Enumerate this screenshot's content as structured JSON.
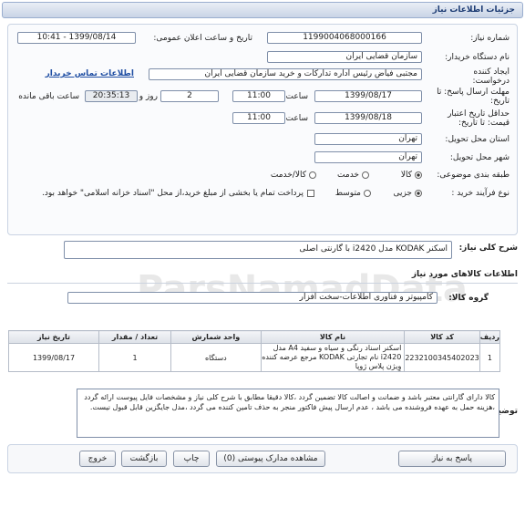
{
  "header": {
    "title": "جزئیات اطلاعات نیاز"
  },
  "form": {
    "need_number_label": "شماره نیاز:",
    "need_number": "1199004068000166",
    "announce_label": "تاریخ و ساعت اعلان عمومی:",
    "announce_value": "1399/08/14 - 10:41",
    "buyer_org_label": "نام دستگاه خریدار:",
    "buyer_org": "سازمان قضایی ایران",
    "creator_label": "ایجاد کننده درخواست:",
    "creator": "مجتبی  فیاض رئیس اداره تدارکات و خرید سازمان قضایی ایران",
    "contact_link": "اطلاعات تماس خریدار",
    "reply_deadline_label": "مهلت ارسال پاسخ: تا تاریخ:",
    "reply_date": "1399/08/17",
    "time_label": "ساعت",
    "reply_time": "11:00",
    "days_value": "2",
    "days_label": "روز و",
    "remaining_time": "20:35:13",
    "remaining_label": "ساعت باقی مانده",
    "validity_label": "حداقل تاریخ اعتبار قیمت: تا تاریخ:",
    "validity_date": "1399/08/18",
    "validity_time": "11:00",
    "province_label": "استان محل تحویل:",
    "province": "تهران",
    "city_label": "شهر محل تحویل:",
    "city": "تهران",
    "category_label": "طبقه بندی موضوعی:",
    "category_options": [
      "کالا",
      "خدمت",
      "کالا/خدمت"
    ],
    "process_label": "نوع فرآیند خرید :",
    "process_options": [
      "جزیی",
      "متوسط"
    ],
    "payment_note": "پرداخت تمام یا بخشی از مبلغ خرید،از محل \"اسناد خزانه اسلامی\" خواهد بود."
  },
  "summary": {
    "label": "شرح کلی نیاز:",
    "text": "اسکنر KODAK مدل  i2420 با گارنتی اصلی"
  },
  "goods_info": {
    "title": "اطلاعات کالاهای مورد نیاز",
    "group_label": "گروه کالا:",
    "group_value": "کامپیوتر و فناوری اطلاعات-سخت افزار"
  },
  "table": {
    "headers": [
      "ردیف",
      "کد کالا",
      "نام کالا",
      "واحد شمارش",
      "تعداد / مقدار",
      "تاریخ نیاز"
    ],
    "rows": [
      {
        "row": "1",
        "code": "2232100345402023",
        "name": "اسکنر اسناد رنگی و سیاه و سفید A4 مدل i2420 نام تجارتی KODAK مرجع عرضه کننده وِیژن پلاس ژوپا",
        "unit": "دستگاه",
        "qty": "1",
        "date": "1399/08/17"
      }
    ]
  },
  "notes": {
    "label": "توضیحات خریدار:",
    "text": "کالا دارای گارانتی معتبر باشد و ضمانت و اصالت کالا تضمین گردد ،کالا دقیقا مطابق با شرح کلی نیاز و مشخصات فایل پیوست ارائه گردد ،هزینه حمل به عهده فروشنده می باشد ، عدم ارسال پیش فاکتور منجر به حذف تامین کننده می گردد ،مدل جایگزین قابل قبول نیست."
  },
  "buttons": {
    "reply": "پاسخ به نیاز",
    "attachments": "مشاهده مدارک پیوستی (0)",
    "print": "چاپ",
    "back": "بازگشت",
    "exit": "خروج"
  },
  "watermark": "ParsNamadData"
}
